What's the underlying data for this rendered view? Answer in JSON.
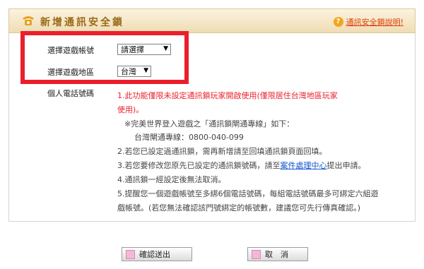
{
  "header": {
    "title": "新增通訊安全鎖",
    "help_link": "通訊安全鎖說明!"
  },
  "form": {
    "account_label": "選擇遊戲帳號",
    "account_select": "請選擇",
    "region_label": "選擇遊戲地區",
    "region_select": "台灣",
    "phone_label": "個人電話號碼"
  },
  "notes": {
    "n1a": "1.此功能僅限未設定通訊鎖玩家開啟使用(僅限居住台灣地區玩家",
    "n1b": "使用)。",
    "star": "※完美世界登入遊戲之「通訊鎖閘通專線」如下：",
    "hotline": "台灣閘通專線：0800-040-099",
    "n2": "2.若您已設定過通訊鎖，需再新增請至回填通訊鎖頁面回填。",
    "n3_pre": "3.若您要修改您原先已設定的通訊鎖號碼，請至",
    "n3_link": "案件處理中心",
    "n3_post": "提出申請。",
    "n4": "4.通訊鎖一經設定後無法取消。",
    "n5a": "5.提醒您一個遊戲帳號至多綁6個電話號碼，每組電話號碼最多可綁定六組遊",
    "n5b": "戲帳號。(若您無法確認該門號綁定的帳號數，建議您可先行傳真確認。)"
  },
  "buttons": {
    "submit": "確認送出",
    "cancel": "取　消"
  },
  "colors": {
    "highlight_frame": "#ea1f2a",
    "header_title": "#9a6a18",
    "link": "#e0400a",
    "note_red": "#ea1f2a"
  },
  "icons": {
    "header": "phone-icon",
    "help": "question-icon",
    "dropdown": "caret-down-icon",
    "button": "pink-square-icon"
  }
}
